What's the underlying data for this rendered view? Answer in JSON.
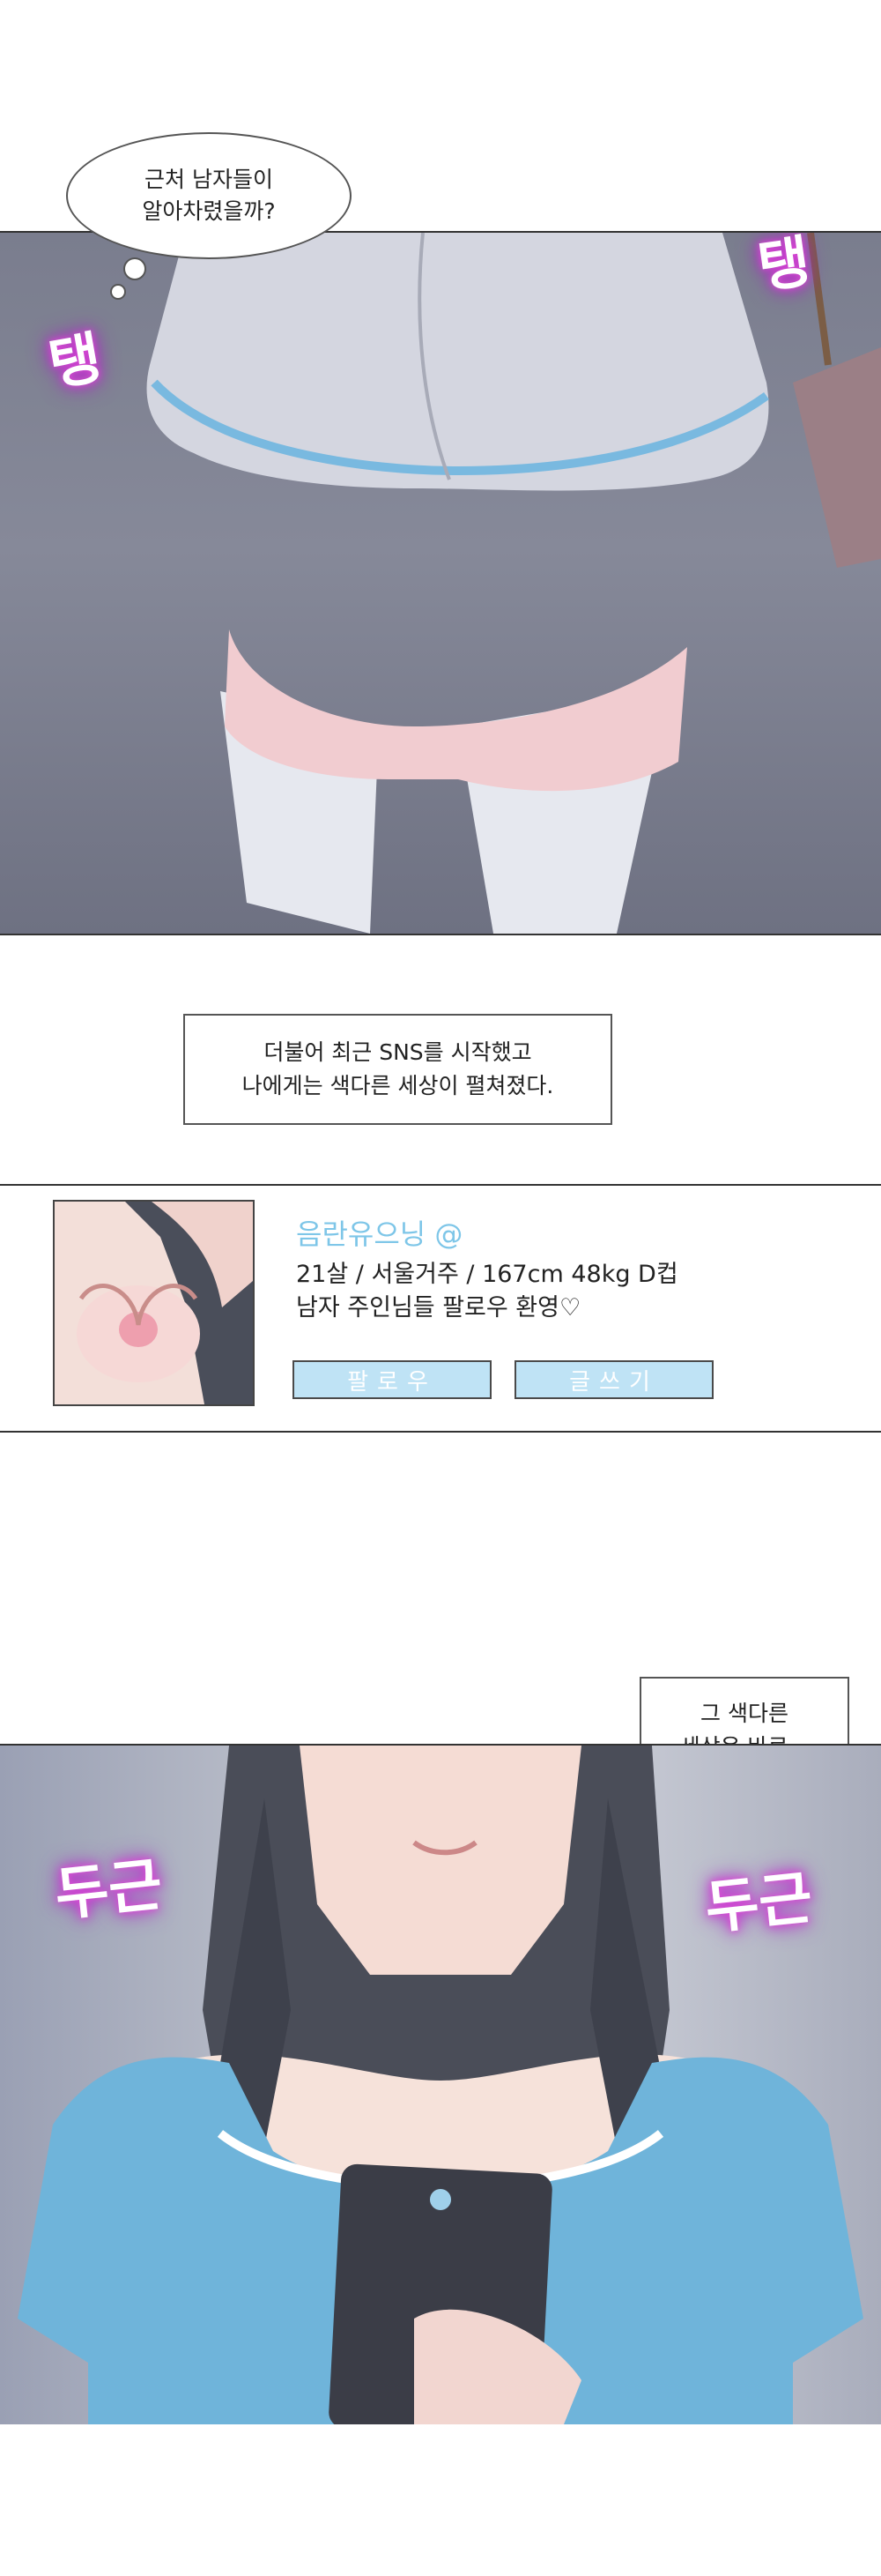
{
  "panel1": {
    "thought_bubble": [
      "근처 남자들이",
      "알아차렸을까?"
    ],
    "sfx_left": "탱",
    "sfx_right": "탱"
  },
  "caption1": [
    "더불어 최근 SNS를 시작했고",
    "나에게는 색다른 세상이 펼쳐졌다."
  ],
  "profile": {
    "name": "음란유으닝 @",
    "line1": "21살 / 서울거주 / 167cm 48kg D컵",
    "line2": "남자 주인님들 팔로우 환영♡",
    "follow_button": "팔로우",
    "write_button": "글쓰기"
  },
  "caption2": [
    "그 색다른",
    "세상은 바로..."
  ],
  "panel3": {
    "sfx_left": "두근",
    "sfx_right": "두근"
  },
  "colors": {
    "panel_bg": "#8a8d9c",
    "accent_blue": "#7ec6e8",
    "glow_pink": "#e34bd8",
    "shirt_blue": "#6fb4da"
  }
}
